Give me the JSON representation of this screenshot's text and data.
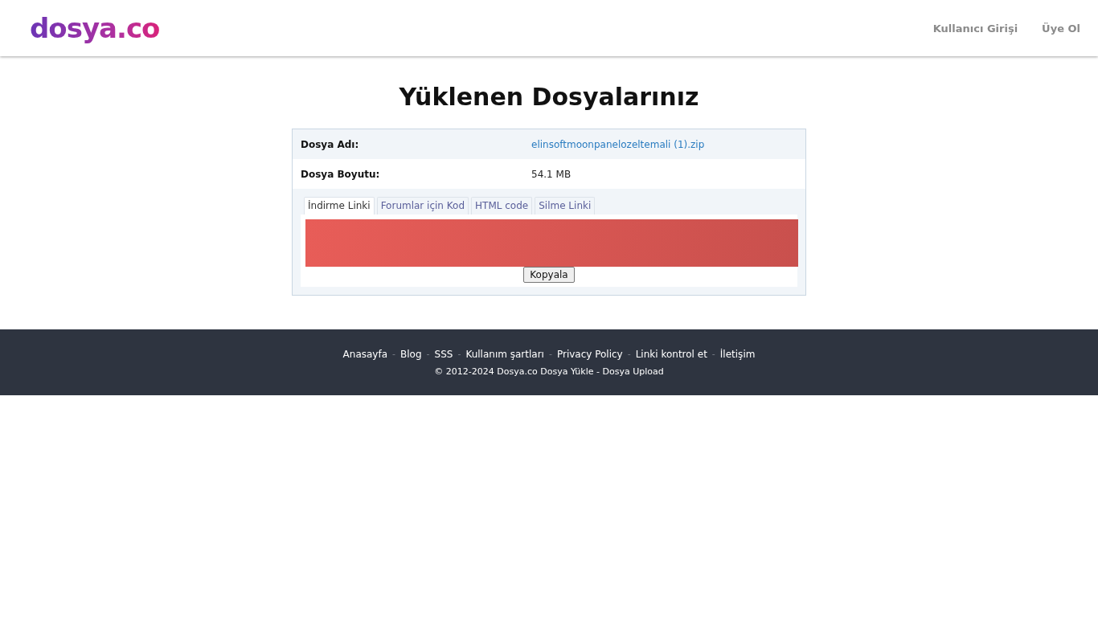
{
  "header": {
    "logo": "dosya.co",
    "nav": [
      "Kullanıcı Girişi",
      "Üye Ol"
    ]
  },
  "title": "Yüklenen Dosyalarınız",
  "details": [
    {
      "label": "Dosya Adı:",
      "value": "elinsoftmoonpanelozeltemali (1).zip",
      "kind": "link"
    },
    {
      "label": "Dosya Boyutu:",
      "value": "54.1 MB",
      "kind": "text"
    }
  ],
  "tabs": [
    {
      "label": "İndirme Linki",
      "selected": true
    },
    {
      "label": "Forumlar için Kod",
      "selected": false
    },
    {
      "label": "HTML code",
      "selected": false
    },
    {
      "label": "Silme Linki",
      "selected": false
    }
  ],
  "link_box": {
    "redacted": true,
    "button": "Kopyala"
  },
  "footer": {
    "separator": "-",
    "links": [
      "Anasayfa",
      "Blog",
      "SSS",
      "Kullanım şartları",
      "Privacy Policy",
      "Linki kontrol et",
      "İletişim"
    ],
    "copyright": "© 2012-2024 Dosya.co Dosya Yükle - Dosya Upload"
  }
}
